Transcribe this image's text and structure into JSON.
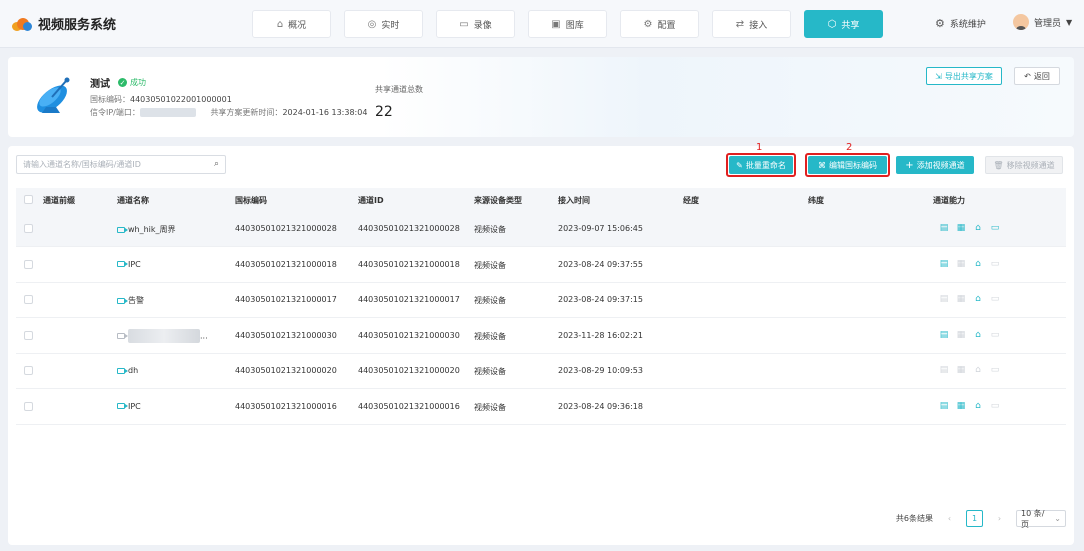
{
  "app": {
    "title": "视频服务系统"
  },
  "nav": [
    {
      "label": "概况",
      "icon": "home-icon",
      "glyph": "⌂",
      "active": false
    },
    {
      "label": "实时",
      "icon": "location-icon",
      "glyph": "◎",
      "active": false
    },
    {
      "label": "录像",
      "icon": "video-icon",
      "glyph": "▭",
      "active": false
    },
    {
      "label": "图库",
      "icon": "image-icon",
      "glyph": "▣",
      "active": false
    },
    {
      "label": "配置",
      "icon": "config-icon",
      "glyph": "⚙",
      "active": false
    },
    {
      "label": "接入",
      "icon": "link-icon",
      "glyph": "⇄",
      "active": false
    },
    {
      "label": "共享",
      "icon": "share-icon",
      "glyph": "⬡",
      "active": true
    }
  ],
  "header": {
    "system_label": "系统维护",
    "user_label": "管理员"
  },
  "info": {
    "name": "测试",
    "status": "成功",
    "gb_code_label": "国标编码：",
    "gb_code": "44030501022001000001",
    "signal_label": "信令IP/端口：",
    "update_label": "共享方案更新时间：",
    "update_time": "2024-01-16 13:38:04",
    "total_label": "共享通道总数",
    "total_value": "22",
    "export_label": "导出共享方案",
    "back_label": "返回"
  },
  "toolbar": {
    "search_placeholder": "请输入通道名称/国标编码/通道ID",
    "batch_rename": "批量重命名",
    "edit_gb": "编辑国标编码",
    "add_channel": "添加视频通道",
    "remove_channel": "移除视频通道",
    "marker_1": "1",
    "marker_2": "2"
  },
  "table": {
    "columns": [
      "通道前缀",
      "通道名称",
      "国标编码",
      "通道ID",
      "来源设备类型",
      "接入时间",
      "经度",
      "纬度",
      "通道能力"
    ],
    "rows": [
      {
        "prefix": "",
        "name": "wh_hik_周界",
        "gb": "44030501021321000028",
        "id": "44030501021321000028",
        "type": "视频设备",
        "time": "2023-09-07 15:06:45",
        "lng": "",
        "lat": "",
        "caps": [
          true,
          true,
          true,
          true
        ]
      },
      {
        "prefix": "",
        "name": "IPC",
        "gb": "44030501021321000018",
        "id": "44030501021321000018",
        "type": "视频设备",
        "time": "2023-08-24 09:37:55",
        "lng": "",
        "lat": "",
        "caps": [
          true,
          false,
          true,
          false
        ]
      },
      {
        "prefix": "",
        "name": "告警",
        "gb": "44030501021321000017",
        "id": "44030501021321000017",
        "type": "视频设备",
        "time": "2023-08-24 09:37:15",
        "lng": "",
        "lat": "",
        "caps": [
          false,
          false,
          true,
          false
        ]
      },
      {
        "prefix": "",
        "name": "...",
        "gb": "44030501021321000030",
        "id": "44030501021321000030",
        "type": "视频设备",
        "time": "2023-11-28 16:02:21",
        "lng": "",
        "lat": "",
        "caps": [
          true,
          false,
          true,
          false
        ]
      },
      {
        "prefix": "",
        "name": "dh",
        "gb": "44030501021321000020",
        "id": "44030501021321000020",
        "type": "视频设备",
        "time": "2023-08-29 10:09:53",
        "lng": "",
        "lat": "",
        "caps": [
          false,
          false,
          false,
          false
        ]
      },
      {
        "prefix": "",
        "name": "IPC",
        "gb": "44030501021321000016",
        "id": "44030501021321000016",
        "type": "视频设备",
        "time": "2023-08-24 09:36:18",
        "lng": "",
        "lat": "",
        "caps": [
          true,
          true,
          true,
          false
        ]
      }
    ]
  },
  "pagination": {
    "total_text": "共6条结果",
    "current_page": "1",
    "page_size": "10 条/页"
  },
  "colors": {
    "accent": "#26b8c8",
    "success": "#2dbb6a",
    "highlight": "#e02020"
  }
}
